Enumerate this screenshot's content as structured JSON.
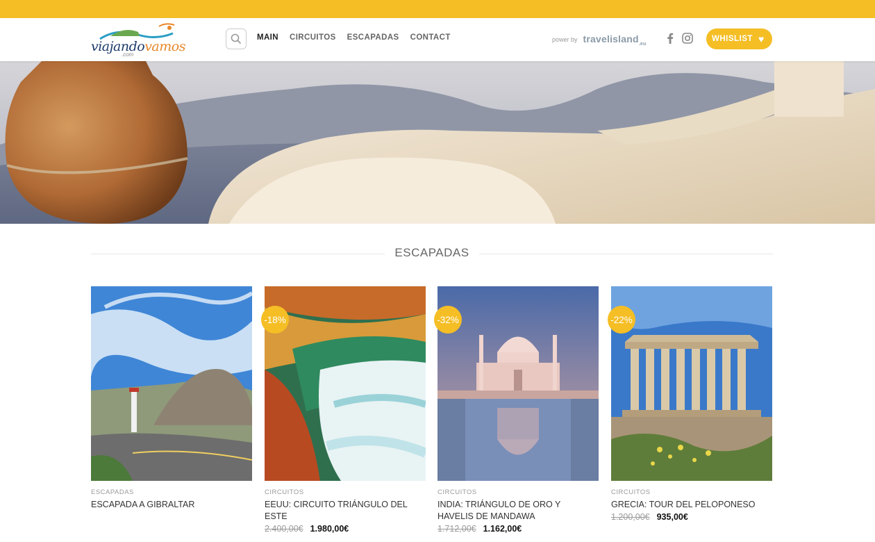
{
  "header": {
    "logo_text_a": "viajando",
    "logo_text_b": "vamos",
    "logo_sub": ".com",
    "nav": [
      "MAIN",
      "CIRCUITOS",
      "ESCAPADAS",
      "CONTACT"
    ],
    "power_by": "power by",
    "power_brand": "travelisland",
    "power_brand_suffix": ".eu",
    "wishlist_label": "WHISLIST"
  },
  "section": {
    "title": "ESCAPADAS"
  },
  "products": [
    {
      "category": "ESCAPADAS",
      "title": "ESCAPADA A GIBRALTAR",
      "old_price": "",
      "new_price": "",
      "discount": ""
    },
    {
      "category": "CIRCUITOS",
      "title": "EEUU: CIRCUITO TRIÁNGULO DEL ESTE",
      "old_price": "2.400,00€",
      "new_price": "1.980,00€",
      "discount": "-18%"
    },
    {
      "category": "CIRCUITOS",
      "title": "INDIA: TRIÁNGULO DE ORO Y HAVELIS DE MANDAWA",
      "old_price": "1.712,00€",
      "new_price": "1.162,00€",
      "discount": "-32%"
    },
    {
      "category": "CIRCUITOS",
      "title": "GRECIA: TOUR DEL PELOPONESO",
      "old_price": "1.200,00€",
      "new_price": "935,00€",
      "discount": "-22%"
    }
  ],
  "colors": {
    "accent": "#f5be25",
    "brand_blue": "#1c3a6b"
  }
}
